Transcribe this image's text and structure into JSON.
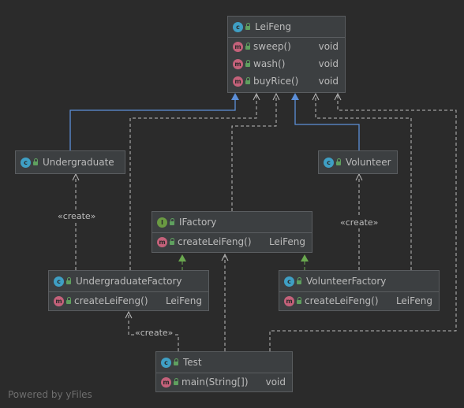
{
  "classes": {
    "leifeng": {
      "name": "LeiFeng",
      "members": [
        {
          "name": "sweep()",
          "type": "void"
        },
        {
          "name": "wash()",
          "type": "void"
        },
        {
          "name": "buyRice()",
          "type": "void"
        }
      ]
    },
    "undergraduate": {
      "name": "Undergraduate"
    },
    "volunteer": {
      "name": "Volunteer"
    },
    "ifactory": {
      "name": "IFactory",
      "members": [
        {
          "name": "createLeiFeng()",
          "type": "LeiFeng"
        }
      ]
    },
    "undergraduate_factory": {
      "name": "UndergraduateFactory",
      "members": [
        {
          "name": "createLeiFeng()",
          "type": "LeiFeng"
        }
      ]
    },
    "volunteer_factory": {
      "name": "VolunteerFactory",
      "members": [
        {
          "name": "createLeiFeng()",
          "type": "LeiFeng"
        }
      ]
    },
    "test": {
      "name": "Test",
      "members": [
        {
          "name": "main(String[])",
          "type": "void"
        }
      ]
    }
  },
  "edge_labels": {
    "create_undergraduate": "«create»",
    "create_volunteer": "«create»",
    "create_factory": "«create»"
  },
  "icons": {
    "class": "class-icon",
    "interface": "interface-icon",
    "method": "method-icon",
    "public": "lock-icon"
  },
  "colors": {
    "background": "#2b2b2b",
    "node": "#3c3f41",
    "inheritance": "#5c8fd8",
    "implementation": "#6aa84f",
    "dependency": "#bbbbbb"
  },
  "footer": {
    "watermark": "Powered by yFiles"
  }
}
